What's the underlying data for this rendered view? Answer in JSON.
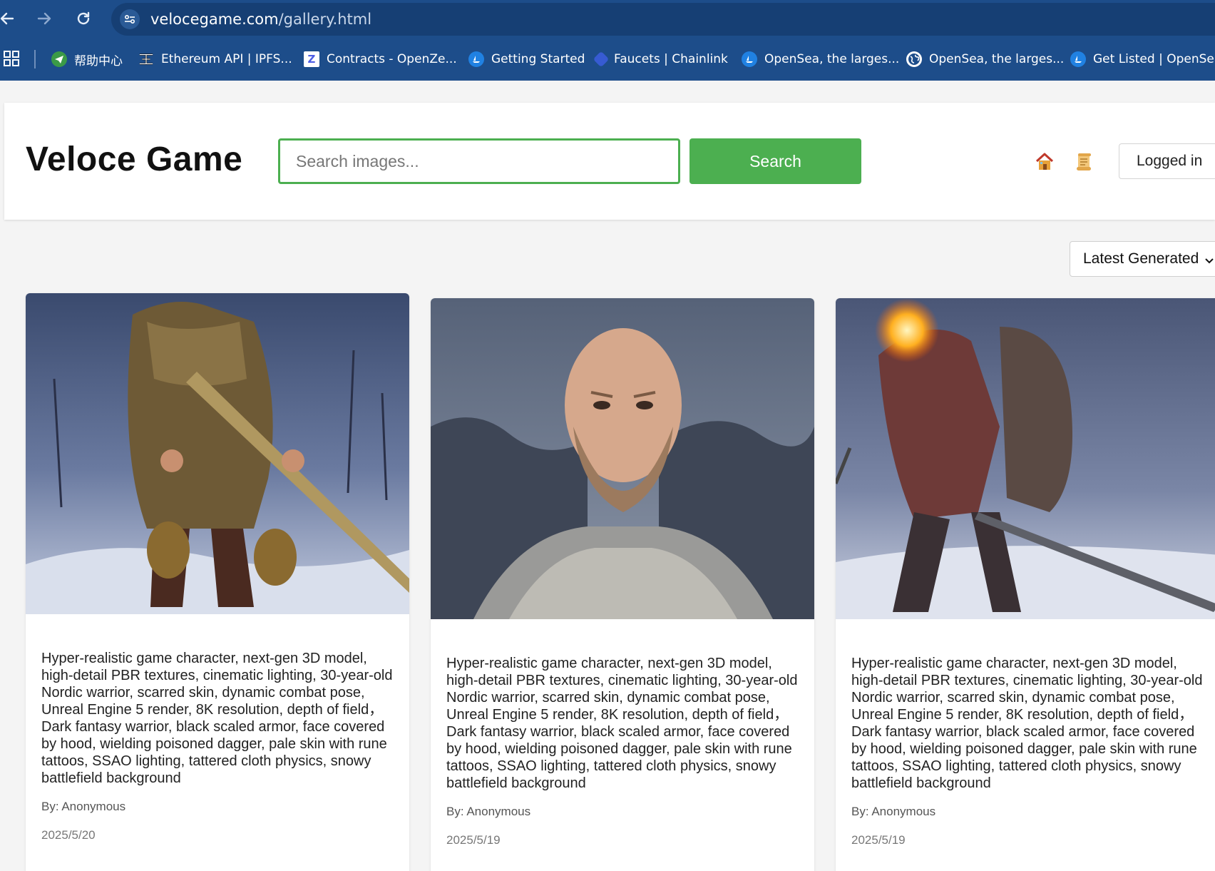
{
  "browser": {
    "url_host": "velocegame.com",
    "url_path": "/gallery.html",
    "bookmarks": [
      {
        "label": "帮助中心",
        "icon": "paper-plane-icon",
        "color": "#3b9a47"
      },
      {
        "label": "Ethereum API | IPFS...",
        "icon": "infura-icon",
        "color": "#111111"
      },
      {
        "label": "Contracts - OpenZe...",
        "icon": "openzeppelin-icon",
        "color": "#ffffff"
      },
      {
        "label": "Getting Started",
        "icon": "opensea-icon",
        "color": "#2081e2"
      },
      {
        "label": "Faucets | Chainlink",
        "icon": "chainlink-icon",
        "color": "#375bd2"
      },
      {
        "label": "OpenSea, the larges...",
        "icon": "opensea-icon",
        "color": "#2081e2"
      },
      {
        "label": "OpenSea, the larges...",
        "icon": "globe-icon",
        "color": "#ffffff"
      },
      {
        "label": "Get Listed | OpenSea",
        "icon": "opensea-icon",
        "color": "#2081e2"
      }
    ]
  },
  "header": {
    "logo": "Veloce Game",
    "search_placeholder": "Search images...",
    "search_button": "Search",
    "home_icon": "house-icon",
    "scroll_icon": "scroll-icon",
    "logged_in_label": "Logged in"
  },
  "sort": {
    "selected": "Latest Generated"
  },
  "cards": [
    {
      "prompt": "Hyper-realistic game character, next-gen 3D model, high-detail PBR textures, cinematic lighting, 30-year-old Nordic warrior, scarred skin, dynamic combat pose, Unreal Engine 5 render, 8K resolution, depth of field， Dark fantasy warrior, black scaled armor, face covered by hood, wielding poisoned dagger, pale skin with rune tattoos, SSAO lighting, tattered cloth physics, snowy battlefield background",
      "author": "By: Anonymous",
      "date": "2025/5/20"
    },
    {
      "prompt": "Hyper-realistic game character, next-gen 3D model, high-detail PBR textures, cinematic lighting, 30-year-old Nordic warrior, scarred skin, dynamic combat pose, Unreal Engine 5 render, 8K resolution, depth of field， Dark fantasy warrior, black scaled armor, face covered by hood, wielding poisoned dagger, pale skin with rune tattoos, SSAO lighting, tattered cloth physics, snowy battlefield background",
      "author": "By: Anonymous",
      "date": "2025/5/19"
    },
    {
      "prompt": "Hyper-realistic game character, next-gen 3D model, high-detail PBR textures, cinematic lighting, 30-year-old Nordic warrior, scarred skin, dynamic combat pose, Unreal Engine 5 render, 8K resolution, depth of field， Dark fantasy warrior, black scaled armor, face covered by hood, wielding poisoned dagger, pale skin with rune tattoos, SSAO lighting, tattered cloth physics, snowy battlefield background",
      "author": "By: Anonymous",
      "date": "2025/5/19"
    }
  ],
  "colors": {
    "chrome": "#1d4d8a",
    "accent_green": "#4caf50",
    "page_bg": "#f4f4f4"
  }
}
